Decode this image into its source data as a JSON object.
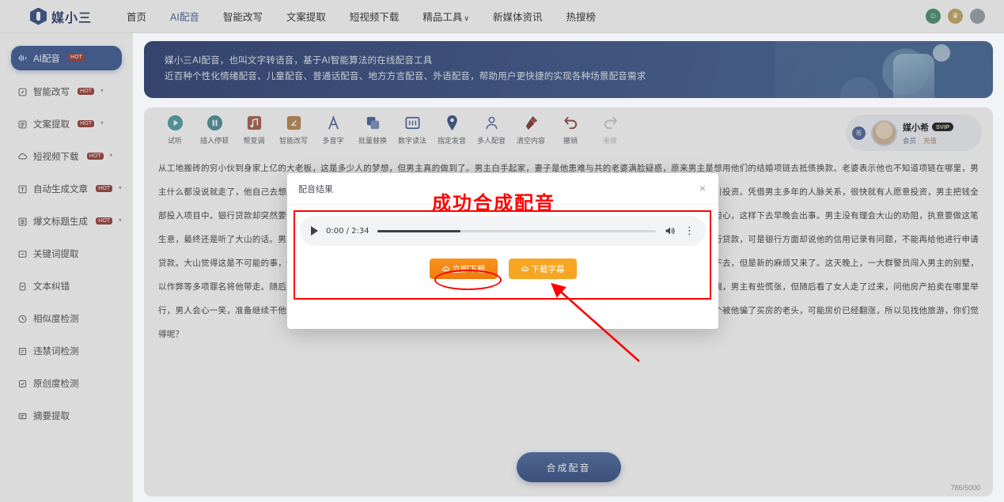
{
  "header": {
    "logo_text": "媒小三",
    "nav": [
      {
        "label": "首页",
        "active": false
      },
      {
        "label": "AI配音",
        "active": true
      },
      {
        "label": "智能改写",
        "active": false
      },
      {
        "label": "文案提取",
        "active": false
      },
      {
        "label": "短视频下载",
        "active": false
      },
      {
        "label": "精品工具",
        "active": false,
        "caret": "∨"
      },
      {
        "label": "新媒体资讯",
        "active": false
      },
      {
        "label": "热搜榜",
        "active": false
      }
    ],
    "icons": [
      {
        "name": "customer-service-icon",
        "glyph": "☺"
      },
      {
        "name": "vip-crown-icon",
        "glyph": "♛"
      },
      {
        "name": "user-avatar-icon",
        "glyph": "●"
      }
    ]
  },
  "sidebar": {
    "items": [
      {
        "label": "AI配音",
        "icon": "waveform-icon",
        "badge": "HOT",
        "star": false,
        "active": true
      },
      {
        "label": "智能改写",
        "icon": "pen-square-icon",
        "badge": "HOT",
        "star": true,
        "active": false
      },
      {
        "label": "文案提取",
        "icon": "doc-lines-icon",
        "badge": "HOT",
        "star": true,
        "active": false
      },
      {
        "label": "短视频下载",
        "icon": "cloud-download-icon",
        "badge": "HOT",
        "star": true,
        "active": false
      },
      {
        "label": "自动生成文章",
        "icon": "text-box-icon",
        "badge": "HOT",
        "star": true,
        "active": false
      },
      {
        "label": "爆文标题生成",
        "icon": "list-lines-icon",
        "badge": "HOT",
        "star": true,
        "active": false
      },
      {
        "label": "关键词提取",
        "icon": "tag-icon",
        "badge": "",
        "star": false,
        "active": false
      },
      {
        "label": "文本纠错",
        "icon": "check-doc-icon",
        "badge": "",
        "star": false,
        "active": false
      },
      {
        "label": "相似度检测",
        "icon": "compare-icon",
        "badge": "",
        "star": false,
        "active": false
      },
      {
        "label": "违禁词检测",
        "icon": "shield-text-icon",
        "badge": "",
        "star": false,
        "active": false
      },
      {
        "label": "原创度检测",
        "icon": "verified-icon",
        "badge": "",
        "star": false,
        "active": false
      },
      {
        "label": "摘要提取",
        "icon": "summary-icon",
        "badge": "",
        "star": false,
        "active": false
      }
    ]
  },
  "banner": {
    "line1": "媒小三AI配音，也叫文字转语音，基于AI智能算法的在线配音工具",
    "line2": "近百种个性化情绪配音、儿童配音、普通话配音、地方方言配音、外语配音，帮助用户更快捷的实现各种场景配音需求"
  },
  "toolbar": [
    {
      "label": "试听",
      "icon": "play-circle-icon",
      "color": "#14b8c4",
      "disabled": false,
      "caret": false
    },
    {
      "label": "插入停顿",
      "icon": "pause-circle-icon",
      "color": "#17a9b5",
      "disabled": false,
      "caret": false
    },
    {
      "label": "帮变调",
      "icon": "music-box-icon",
      "color": "#ef5b33",
      "disabled": false,
      "caret": false
    },
    {
      "label": "智能改写",
      "icon": "edit-box-icon",
      "color": "#f0881f",
      "disabled": false,
      "caret": false
    },
    {
      "label": "多音字",
      "icon": "polyphone-icon",
      "color": "#3a6fe0",
      "disabled": false,
      "caret": false
    },
    {
      "label": "批量替换",
      "icon": "replace-icon",
      "color": "#3a6fe0",
      "disabled": false,
      "caret": true
    },
    {
      "label": "数字读法",
      "icon": "number-read-icon",
      "color": "#3a6fe0",
      "disabled": false,
      "caret": false
    },
    {
      "label": "指定发音",
      "icon": "speaker-pin-icon",
      "color": "#2f5fd0",
      "disabled": false,
      "caret": false
    },
    {
      "label": "多人配音",
      "icon": "multi-user-icon",
      "color": "#4a7de8",
      "disabled": false,
      "caret": false
    },
    {
      "label": "清空内容",
      "icon": "broom-icon",
      "color": "#e0452f",
      "disabled": false,
      "caret": false
    },
    {
      "label": "撤销",
      "icon": "undo-icon",
      "color": "#e0452f",
      "disabled": false,
      "caret": false
    },
    {
      "label": "重做",
      "icon": "redo-icon",
      "color": "#c9ced5",
      "disabled": true,
      "caret": false
    }
  ],
  "account": {
    "coin": "币",
    "name": "媒小希",
    "svip": "SVIP",
    "link1": "会员",
    "link2": "充值"
  },
  "document": {
    "text": "从工地搬砖的穷小伙到身家上亿的大老板，这是多少人的梦想，但男主真的做到了。男主白手起家，妻子是他患难与共的老婆满脸疑惑，原来男主是想用他们的结婚项链去抵债换款。老婆表示他也不知道项链在哪里，男主什么都没说就走了，他自己去想办法。公司的资金链断裂得很快，又遇到了新的解决办法。他们找到广告公司拍了个宣传片，谎称地产项目正在吸引投资。凭借男主多年的人脉关系，很快就有人愿意投资，男主把钱全部投入项目中。银行贷款却突然要债，他们的资金周转不过来，又将银行贷款全部投入，这次要是成功能赚三千万。面对心浮气躁的男主，大山非常担心，这样下去早晚会出事。男主没有理会大山的劝阻，执意要做这笔生意，最终还是听了大山的话。男主这才意识到妻子是银行高管。果然，他的贷款被全部叫停，工人拿不到钱纷纷罢工。男主焦头烂额，他只好去银行贷款，可是银行方面却说他的信用记录有问题，不能再给他进行申请贷款。大山觉得这是不可能的事，但财务却说他有办法。他们检查了两个有开银行资质的客房，然后很快就办理了手续，男主的公司才得以继续运转下去，但是新的麻烦又来了。这天晚上，一大群警员闯入男主的别墅，以作弊等多项罪名将他带走。随后男主被判了七年七年后，男主出狱，一无所有的他走在大街上，遇到了那个曾经被他骗走钱财的老头，两人面面相觑，男主有些慌张，但随后看了女人走了过来，问他房产拍卖在哪里举行，男人会心一笑，准备继续干他的老本行。电影到此结束，男主能否再次翻身没人知道，但聪明的头脑用不对地方肯定还会玩，但话又说回来，那个被他骗了买房的老头，可能房价已经翻涨，所以见找他旅游，你们觉得呢？"
  },
  "compose": {
    "button_label": "合成配音",
    "char_count": "786/5000"
  },
  "modal": {
    "title": "配音结果",
    "close_glyph": "×",
    "player": {
      "current_time": "0:00",
      "separator": "/",
      "duration": "2:34",
      "time_display": "0:00 / 2:34",
      "progress_percent": 30,
      "volume_icon": "volume-icon",
      "menu_glyph": "⋮"
    },
    "buttons": [
      {
        "label": "立即下载",
        "icon": "download-cloud-icon",
        "style": "primary"
      },
      {
        "label": "下载字幕",
        "icon": "download-cloud-icon",
        "style": "secondary"
      }
    ]
  },
  "annotations": {
    "title": "成功合成配音",
    "color": "#ff0000"
  }
}
